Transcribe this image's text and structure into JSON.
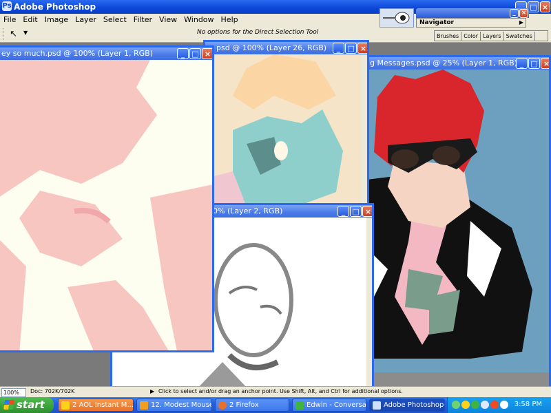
{
  "app": {
    "title": "Adobe Photoshop",
    "icon_letter": "Ps"
  },
  "menu": [
    "File",
    "Edit",
    "Image",
    "Layer",
    "Select",
    "Filter",
    "View",
    "Window",
    "Help"
  ],
  "options": {
    "message": "No options for the Direct Selection Tool"
  },
  "palettes": {
    "navigator_label": "Navigator",
    "tabs": [
      "Brushes",
      "Color",
      "Layers",
      "Swatches"
    ]
  },
  "documents": [
    {
      "id": "doc1",
      "title": "ey so much.psd @ 100% (Layer 1, RGB)"
    },
    {
      "id": "doc2",
      "title": "psd @ 100% (Layer 26, RGB)"
    },
    {
      "id": "doc3",
      "title": "0% (Layer 2, RGB)"
    },
    {
      "id": "doc4",
      "title": "g Messages.psd @ 25% (Layer 1, RGB)"
    }
  ],
  "status": {
    "zoom": "100%",
    "doc_size": "Doc: 702K/702K",
    "message": "Click to select and/or drag an anchor point.  Use Shift, Alt, and Ctrl for additional options."
  },
  "taskbar": {
    "start_label": "start",
    "tasks": [
      {
        "label": "2 AOL Instant M...",
        "state": "flash"
      },
      {
        "label": "12. Modest Mouse...",
        "state": "normal"
      },
      {
        "label": "2 Firefox",
        "state": "normal"
      },
      {
        "label": "Edwin - Conversat...",
        "state": "normal"
      },
      {
        "label": "Adobe Photoshop",
        "state": "active"
      }
    ],
    "clock": "3:58 PM"
  },
  "colors": {
    "accent": "#2a6af0",
    "pink_art": "#f7c6c0",
    "cream_art": "#fdfdf0",
    "hair_red": "#d8262c",
    "teal_face": "#8fcfcb",
    "blue_bg": "#6d9fbe"
  }
}
